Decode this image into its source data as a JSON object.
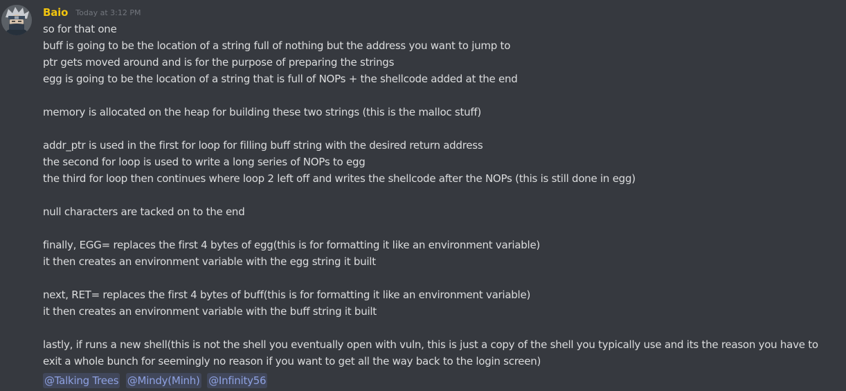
{
  "message": {
    "author": "Baio",
    "timestamp": "Today at 3:12 PM",
    "avatar_icon": "ninja-avatar",
    "author_color": "#f1c40f",
    "lines": [
      "so for that one",
      "buff is going to be the location of a string full of nothing but the address you want to jump to",
      "ptr gets moved around and is for the purpose of preparing the strings",
      "egg is going to be the location of a string that is full of NOPs + the shellcode added at the end",
      "",
      "memory is allocated on the heap for building these two strings (this is the malloc stuff)",
      "",
      "addr_ptr is used in the first for loop for filling buff string with the desired return address",
      "the second for loop is used to write a long series of NOPs to egg",
      "the third for loop then continues where loop 2 left off and writes the shellcode after the NOPs (this is still done in egg)",
      "",
      "null characters are tacked on to the end",
      "",
      "finally, EGG= replaces the first 4 bytes of egg(this is for formatting it like an environment variable)",
      "it then creates an environment variable with the egg string it built",
      "",
      "next, RET= replaces the first 4 bytes of buff(this is for formatting it like an environment variable)",
      "it then creates an environment variable with the buff string it built",
      "",
      "lastly, if runs a new shell(this is not the shell you eventually open with vuln, this is just a copy of the shell you typically use and its the reason you have to exit a whole bunch for seemingly no reason if you want to get all the way back to the login screen)"
    ],
    "mentions": [
      "@Talking Trees",
      "@Mindy(Minh)",
      "@Infinity56"
    ]
  },
  "colors": {
    "background": "#36393f",
    "text": "#dcddde",
    "timestamp": "#72767d",
    "mention_text": "#8ea1e1",
    "mention_bg": "rgba(114,137,218,0.18)"
  }
}
